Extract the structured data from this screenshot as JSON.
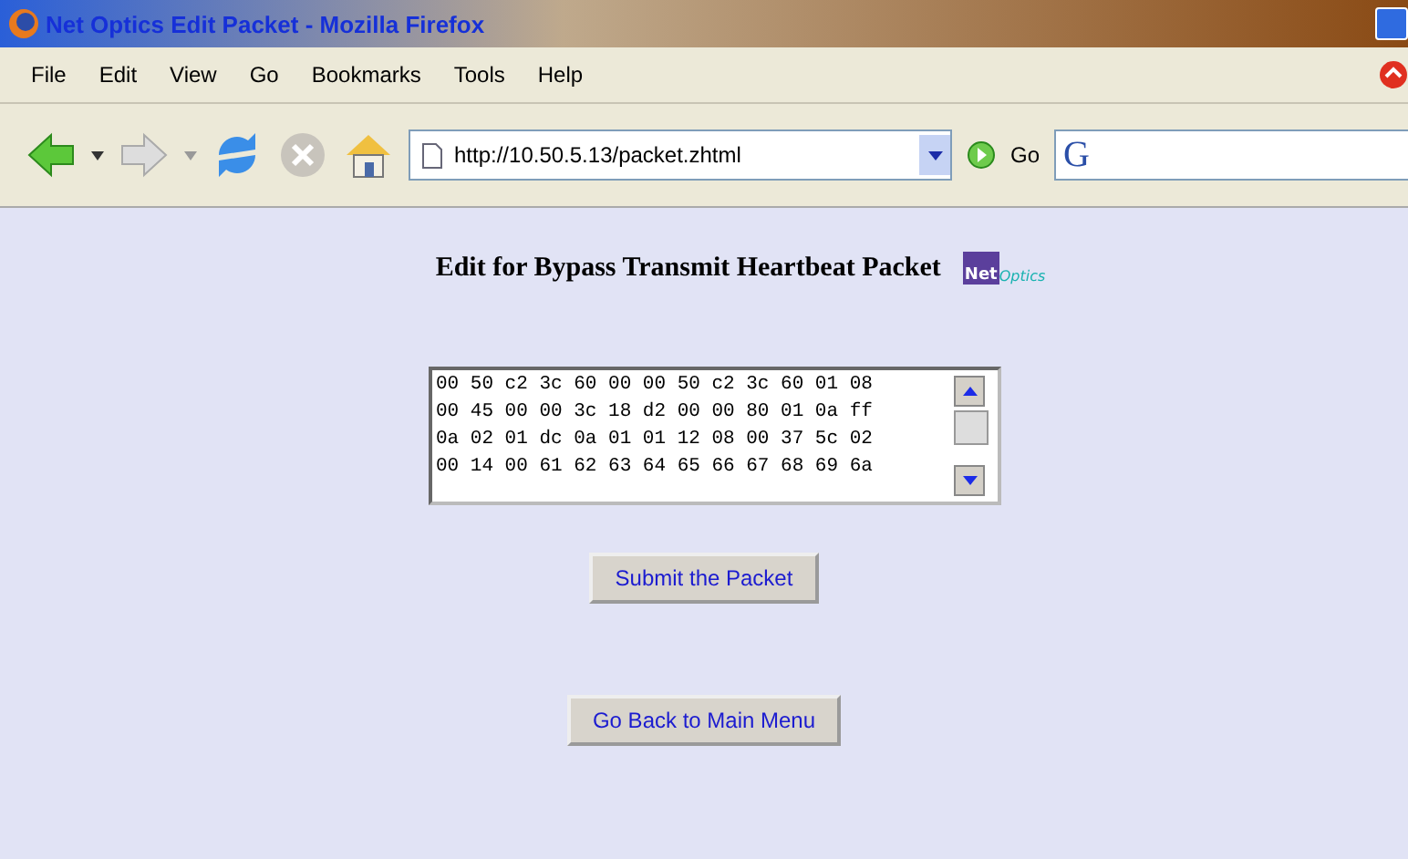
{
  "window": {
    "title": "Net Optics Edit Packet - Mozilla Firefox"
  },
  "menu": [
    "File",
    "Edit",
    "View",
    "Go",
    "Bookmarks",
    "Tools",
    "Help"
  ],
  "toolbar": {
    "address": "http://10.50.5.13/packet.zhtml",
    "go_label": "Go",
    "search_placeholder": "G"
  },
  "page": {
    "heading": "Edit for Bypass Transmit Heartbeat Packet",
    "logo": {
      "word_1": "Net",
      "word_2": "Optics"
    },
    "packet_lines": [
      "00 50 c2 3c 60 00 00 50 c2 3c 60 01 08",
      "00 45 00 00 3c 18 d2 00 00 80 01 0a ff",
      "0a 02 01 dc 0a 01 01 12 08 00 37 5c 02",
      "00 14 00 61 62 63 64 65 66 67 68 69 6a"
    ],
    "buttons": [
      "Submit the Packet",
      "Go Back to Main Menu"
    ]
  }
}
